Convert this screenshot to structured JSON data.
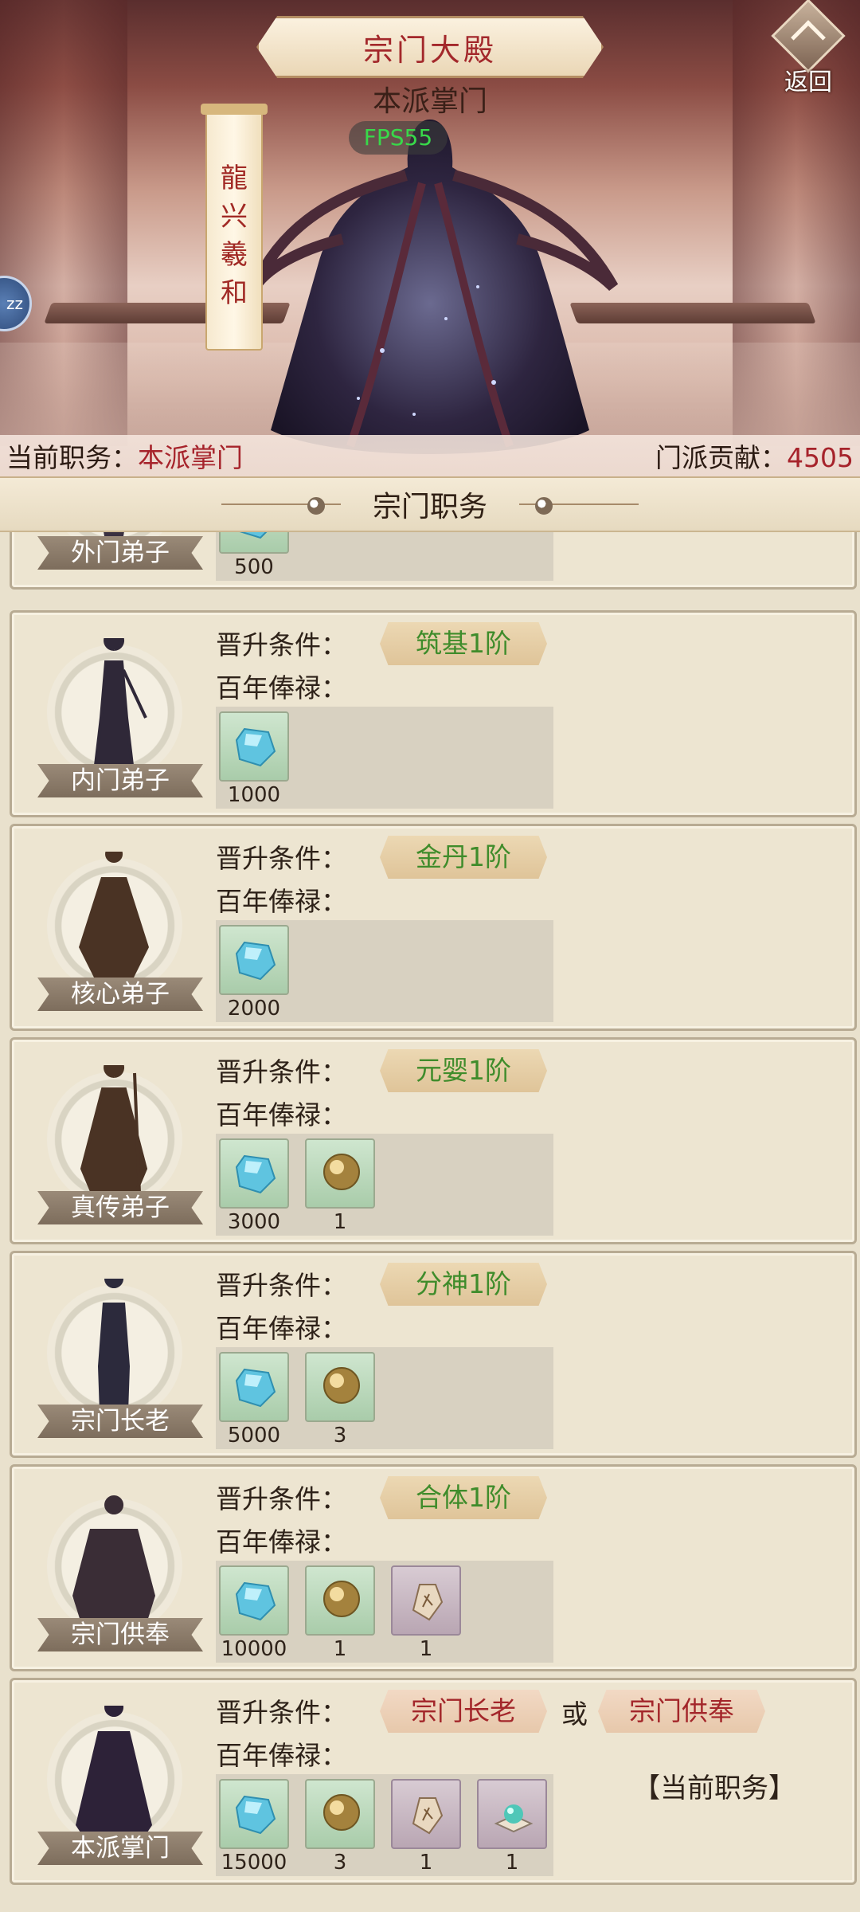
{
  "header": {
    "title": "宗门大殿",
    "leader_title": "本派掌门",
    "fps": "FPS55",
    "leader_name_chars": [
      "龍",
      "兴",
      "羲",
      "和"
    ],
    "back_label": "返回",
    "side_bubble": "zz"
  },
  "status": {
    "position_label": "当前职务：",
    "position_value": "本派掌门",
    "contribution_label": "门派贡献：",
    "contribution_value": "4505"
  },
  "section_title": "宗门职务",
  "labels": {
    "requirement": "晋升条件：",
    "salary": "百年俸禄：",
    "or": "或",
    "current_position": "【当前职务】"
  },
  "ranks": [
    {
      "name": "外门弟子",
      "requirement": [],
      "rewards": [
        {
          "icon": "spirit-stone-icon",
          "qty": "500"
        }
      ]
    },
    {
      "name": "内门弟子",
      "requirement": [
        "筑基1阶"
      ],
      "rewards": [
        {
          "icon": "spirit-stone-icon",
          "qty": "1000"
        }
      ]
    },
    {
      "name": "核心弟子",
      "requirement": [
        "金丹1阶"
      ],
      "rewards": [
        {
          "icon": "spirit-stone-icon",
          "qty": "2000"
        }
      ]
    },
    {
      "name": "真传弟子",
      "requirement": [
        "元婴1阶"
      ],
      "rewards": [
        {
          "icon": "spirit-stone-icon",
          "qty": "3000"
        },
        {
          "icon": "golden-pill-icon",
          "qty": "1"
        }
      ]
    },
    {
      "name": "宗门长老",
      "requirement": [
        "分神1阶"
      ],
      "rewards": [
        {
          "icon": "spirit-stone-icon",
          "qty": "5000"
        },
        {
          "icon": "golden-pill-icon",
          "qty": "3"
        }
      ]
    },
    {
      "name": "宗门供奉",
      "requirement": [
        "合体1阶"
      ],
      "rewards": [
        {
          "icon": "spirit-stone-icon",
          "qty": "10000"
        },
        {
          "icon": "golden-pill-icon",
          "qty": "1"
        },
        {
          "icon": "token-pouch-icon",
          "qty": "1"
        }
      ]
    },
    {
      "name": "本派掌门",
      "requirement": [
        "宗门长老",
        "宗门供奉"
      ],
      "current": true,
      "rewards": [
        {
          "icon": "spirit-stone-icon",
          "qty": "15000"
        },
        {
          "icon": "golden-pill-icon",
          "qty": "3"
        },
        {
          "icon": "token-pouch-icon",
          "qty": "1"
        },
        {
          "icon": "jade-orb-icon",
          "qty": "1"
        }
      ]
    }
  ],
  "colors": {
    "requirement_realm": "#3f8c2b",
    "requirement_rank": "#a3262a",
    "status_value": "#a6232b",
    "title_text": "#a3282b"
  }
}
